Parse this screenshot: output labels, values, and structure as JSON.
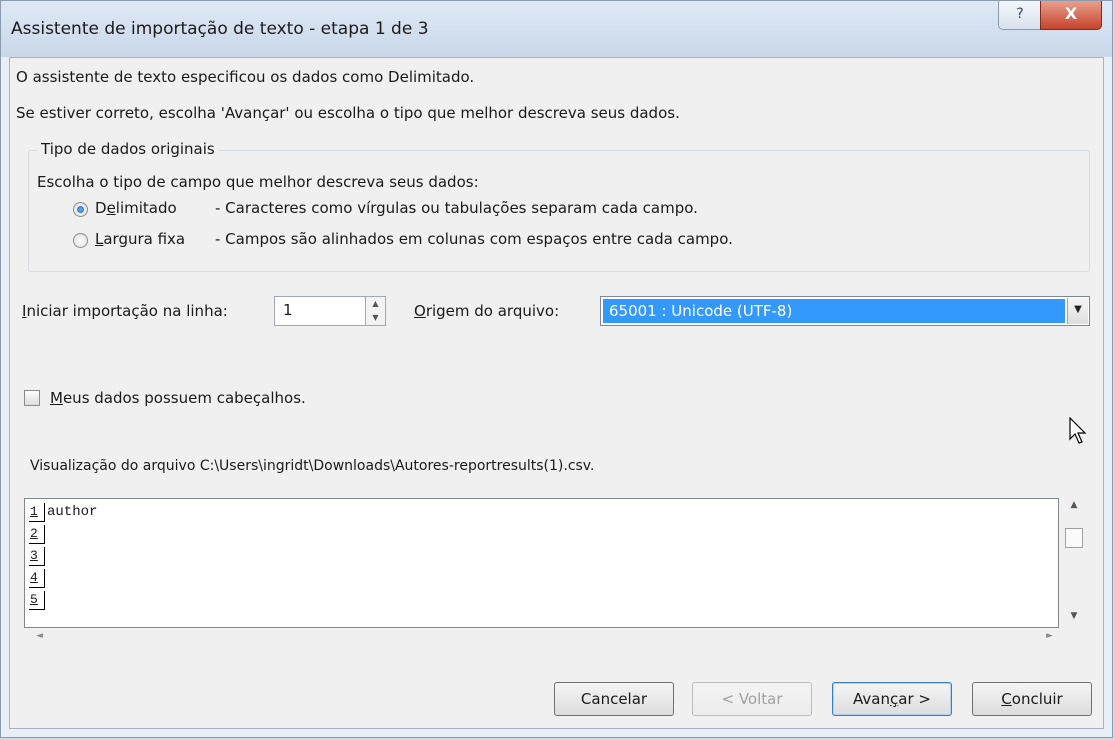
{
  "window": {
    "title": "Assistente de importação de texto - etapa 1 de 3",
    "help_label": "?",
    "close_label": "X"
  },
  "intro": {
    "line1": "O assistente de texto especificou os dados como Delimitado.",
    "line2": "Se estiver correto, escolha 'Avançar' ou escolha o tipo que melhor descreva seus dados."
  },
  "data_type_group": {
    "legend": "Tipo de dados originais",
    "prompt": "Escolha o tipo de campo que melhor descreva seus dados:",
    "options": [
      {
        "label_first": "D",
        "label_u": "e",
        "label_rest": "limitado",
        "description": "- Caracteres como vírgulas ou tabulações separam cada campo.",
        "selected": true
      },
      {
        "label_first": "",
        "label_u": "L",
        "label_rest": "argura fixa",
        "description": "- Campos são alinhados em colunas com espaços entre cada campo.",
        "selected": false
      }
    ]
  },
  "start_row": {
    "label_u": "I",
    "label_rest": "niciar importação na linha:",
    "value": "1"
  },
  "file_origin": {
    "label_u": "O",
    "label_rest": "rigem do arquivo:",
    "value": "65001 : Unicode (UTF-8)"
  },
  "headers_checkbox": {
    "label_u": "M",
    "label_rest": "eus dados possuem cabeçalhos.",
    "checked": false
  },
  "preview": {
    "label": "Visualização do arquivo C:\\Users\\ingridt\\Downloads\\Autores-reportresults(1).csv.",
    "rows": [
      {
        "num": "1",
        "text": "author"
      },
      {
        "num": "2",
        "text": ""
      },
      {
        "num": "3",
        "text": ""
      },
      {
        "num": "4",
        "text": ""
      },
      {
        "num": "5",
        "text": ""
      }
    ]
  },
  "buttons": {
    "cancel": "Cancelar",
    "back": "< Voltar",
    "next_a": "Avan",
    "next_u": "ç",
    "next_b": "ar >",
    "finish_u": "C",
    "finish_rest": "oncluir"
  },
  "colors": {
    "accent": "#3399ff",
    "titlebar": "#c9d7e8",
    "close": "#c7432b"
  }
}
